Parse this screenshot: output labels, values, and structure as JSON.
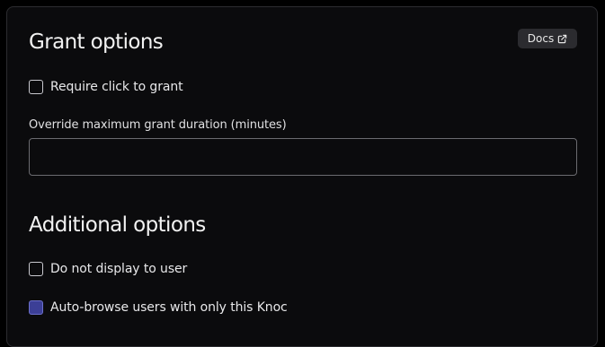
{
  "grant_options": {
    "title": "Grant options",
    "docs_label": "Docs",
    "require_click": {
      "label": "Require click to grant",
      "checked": false
    },
    "max_duration": {
      "label": "Override maximum grant duration (minutes)",
      "value": "",
      "placeholder": ""
    }
  },
  "additional_options": {
    "title": "Additional options",
    "hide_from_user": {
      "label": "Do not display to user",
      "checked": false
    },
    "auto_browse": {
      "label": "Auto-browse users with only this Knoc",
      "checked": false
    }
  },
  "colors": {
    "background": "#0b0b0d",
    "accent": "#3c3f96",
    "docs_button": "#2b2b2f"
  }
}
